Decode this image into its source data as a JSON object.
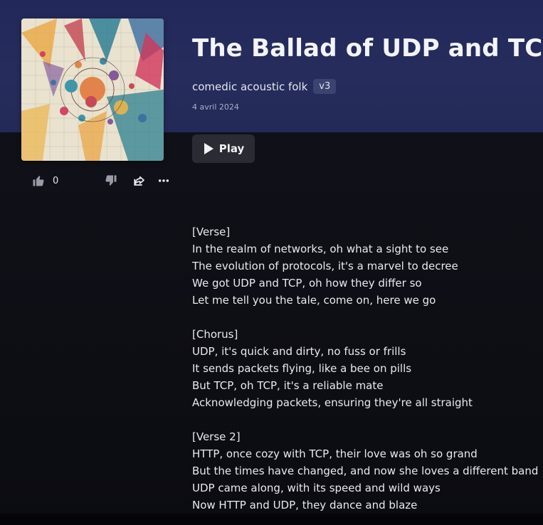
{
  "song": {
    "title": "The Ballad of UDP and TCP",
    "genre": "comedic acoustic folk",
    "version": "v3",
    "date": "4 avril 2024"
  },
  "player": {
    "play_label": "Play"
  },
  "actions": {
    "like_count": "0",
    "icons": [
      "thumbs-up-icon",
      "thumbs-down-icon",
      "share-icon",
      "more-icon"
    ]
  },
  "lyrics": [
    "[Verse]",
    "In the realm of networks, oh what a sight to see",
    "The evolution of protocols, it's a marvel to decree",
    "We got UDP and TCP, oh how they differ so",
    "Let me tell you the tale, come on, here we go",
    "",
    "[Chorus]",
    "UDP, it's quick and dirty, no fuss or frills",
    "It sends packets flying, like a bee on pills",
    "But TCP, oh TCP, it's a reliable mate",
    "Acknowledging packets, ensuring they're all straight",
    "",
    "[Verse 2]",
    "HTTP, once cozy with TCP, their love was oh so grand",
    "But the times have changed, and now she loves a different band",
    "UDP came along, with its speed and wild ways",
    "Now HTTP and UDP, they dance and blaze"
  ],
  "colors": {
    "hero_top": "#22295a",
    "hero_bottom": "#232a57",
    "background": "#0d0e14",
    "badge": "#3b4370",
    "button": "#2a2b33"
  }
}
